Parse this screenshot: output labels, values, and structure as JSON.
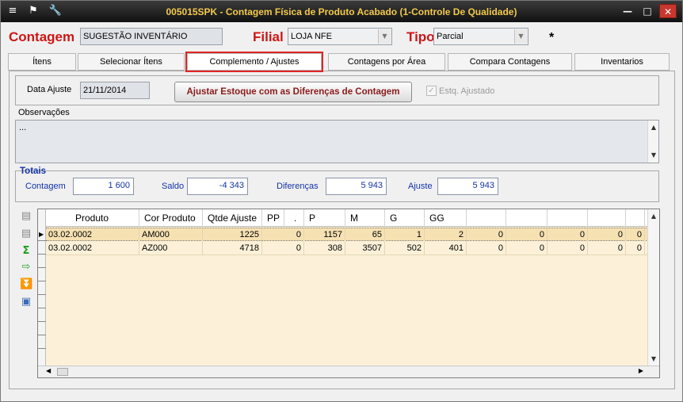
{
  "window": {
    "title": "005015SPK - Contagem Física de Produto Acabado (1-Controle De Qualidade)",
    "min_glyph": "—",
    "max_glyph": "□",
    "close_glyph": "✕"
  },
  "header": {
    "contagem_label": "Contagem",
    "contagem_value": "SUGESTÃO INVENTÁRIO",
    "filial_label": "Filial",
    "filial_value": "LOJA NFE",
    "tipo_label": "Tipo",
    "tipo_value": "Parcial",
    "marker": "*"
  },
  "tabs": [
    {
      "label": "Ítens"
    },
    {
      "label": "Selecionar Ítens"
    },
    {
      "label": "Complemento / Ajustes"
    },
    {
      "label": "Contagens por Área"
    },
    {
      "label": "Compara Contagens"
    },
    {
      "label": "Inventarios"
    }
  ],
  "complemento": {
    "data_ajuste_label": "Data Ajuste",
    "data_ajuste_value": "21/11/2014",
    "ajustar_button": "Ajustar Estoque com as Diferenças de Contagem",
    "estq_ajustado_label": "Estq. Ajustado",
    "observacoes_label": "Observações",
    "observacoes_value": "..."
  },
  "totais": {
    "title": "Totais",
    "contagem_label": "Contagem",
    "contagem_value": "1 600",
    "saldo_label": "Saldo",
    "saldo_value": "-4 343",
    "diferencas_label": "Diferenças",
    "diferencas_value": "5 943",
    "ajuste_label": "Ajuste",
    "ajuste_value": "5 943"
  },
  "grid": {
    "columns": [
      "Produto",
      "Cor Produto",
      "Qtde Ajuste",
      "PP",
      ".",
      "P",
      "M",
      "G",
      "GG",
      "",
      "",
      "",
      "",
      ""
    ],
    "rows": [
      {
        "produto": "03.02.0002",
        "cor": "AM000",
        "qtde": "1225",
        "pp": "0",
        "p": "1157",
        "m": "65",
        "g": "1",
        "gg": "2",
        "c1": "0",
        "c2": "0",
        "c3": "0",
        "c4": "0",
        "c5": "0"
      },
      {
        "produto": "03.02.0002",
        "cor": "AZ000",
        "qtde": "4718",
        "pp": "0",
        "p": "308",
        "m": "3507",
        "g": "502",
        "gg": "401",
        "c1": "0",
        "c2": "0",
        "c3": "0",
        "c4": "0",
        "c5": "0"
      }
    ]
  },
  "side_toolbar": [
    "add-row-icon",
    "remove-row-icon",
    "sum-icon",
    "export-icon",
    "download-icon",
    "image-icon"
  ]
}
